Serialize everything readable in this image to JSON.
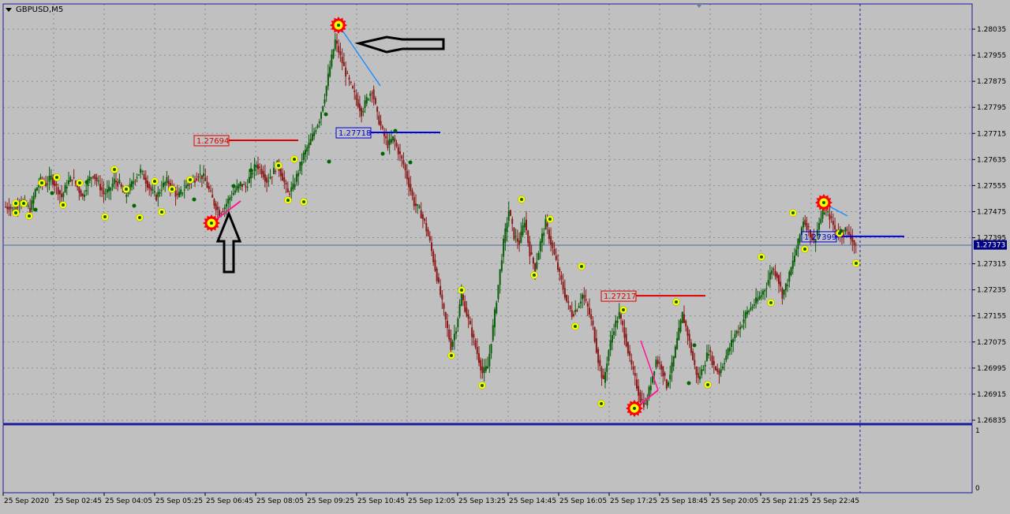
{
  "window": {
    "symbol_timeframe": "GBPUSD,M5"
  },
  "colors": {
    "background": "#c0c0c0",
    "grid": "#8a8a9a",
    "frame": "#1a1a9a",
    "bull_candle": "#0a5e0a",
    "bear_candle": "#8b1a1a",
    "marker_fill": "#ffff00",
    "marker_dot": "#006400",
    "star": "#ff0000",
    "line_blue": "#0000dd",
    "line_red": "#dd0000",
    "line_pink": "#ff1493",
    "line_lightblue": "#1e90ff",
    "current_price_bg": "#000080"
  },
  "chart_data": {
    "type": "candlestick",
    "symbol": "GBPUSD",
    "timeframe": "M5",
    "y_range": [
      1.2683,
      1.281
    ],
    "y_ticks": [
      "1.28035",
      "1.27955",
      "1.27875",
      "1.27795",
      "1.27715",
      "1.27635",
      "1.27555",
      "1.27475",
      "1.27395",
      "1.27315",
      "1.27235",
      "1.27155",
      "1.27075",
      "1.26995",
      "1.26915",
      "1.26835"
    ],
    "x_ticks": [
      "25 Sep 2020",
      "25 Sep 02:45",
      "25 Sep 04:05",
      "25 Sep 05:25",
      "25 Sep 06:45",
      "25 Sep 08:05",
      "25 Sep 09:25",
      "25 Sep 10:45",
      "25 Sep 12:05",
      "25 Sep 13:25",
      "25 Sep 14:45",
      "25 Sep 16:05",
      "25 Sep 17:25",
      "25 Sep 18:45",
      "25 Sep 20:05",
      "25 Sep 21:25",
      "25 Sep 22:45"
    ],
    "current_price": "1.27373",
    "price_levels": [
      {
        "label": "1.27694",
        "value": 1.27694,
        "color": "red"
      },
      {
        "label": "1.27718",
        "value": 1.27718,
        "color": "blue"
      },
      {
        "label": "1.27217",
        "value": 1.27217,
        "color": "red"
      },
      {
        "label": "1.27399",
        "value": 1.27399,
        "color": "blue"
      }
    ],
    "close_path": [
      1.2749,
      1.2749,
      1.2748,
      1.2751,
      1.275,
      1.2748,
      1.2754,
      1.2757,
      1.2756,
      1.2758,
      1.2755,
      1.2752,
      1.2756,
      1.2758,
      1.2755,
      1.2752,
      1.2757,
      1.2759,
      1.2756,
      1.2753,
      1.2754,
      1.2757,
      1.2756,
      1.2752,
      1.2755,
      1.2758,
      1.276,
      1.2757,
      1.2754,
      1.2752,
      1.2755,
      1.2757,
      1.2755,
      1.2752,
      1.2754,
      1.2756,
      1.2757,
      1.2759,
      1.2758,
      1.2754,
      1.275,
      1.2747,
      1.2749,
      1.2752,
      1.2754,
      1.2756,
      1.2755,
      1.2759,
      1.2762,
      1.276,
      1.2757,
      1.2759,
      1.2762,
      1.2758,
      1.2753,
      1.2755,
      1.276,
      1.2765,
      1.2768,
      1.2772,
      1.2776,
      1.2783,
      1.2792,
      1.28,
      1.2795,
      1.279,
      1.2786,
      1.2782,
      1.2778,
      1.2782,
      1.2785,
      1.2777,
      1.2772,
      1.2768,
      1.277,
      1.2766,
      1.2762,
      1.2756,
      1.275,
      1.2748,
      1.2744,
      1.2738,
      1.273,
      1.2722,
      1.2714,
      1.2706,
      1.2712,
      1.2722,
      1.2716,
      1.271,
      1.2704,
      1.2698,
      1.27,
      1.2712,
      1.2725,
      1.2738,
      1.2748,
      1.274,
      1.2738,
      1.2745,
      1.2735,
      1.273,
      1.2738,
      1.2744,
      1.2738,
      1.2732,
      1.2726,
      1.272,
      1.2716,
      1.2718,
      1.2722,
      1.2718,
      1.2712,
      1.2702,
      1.2695,
      1.2705,
      1.2712,
      1.2716,
      1.271,
      1.2702,
      1.2696,
      1.269,
      1.2688,
      1.2695,
      1.2702,
      1.27,
      1.2694,
      1.27,
      1.2708,
      1.2716,
      1.271,
      1.2702,
      1.2696,
      1.27,
      1.2705,
      1.27,
      1.2698,
      1.2702,
      1.2706,
      1.271,
      1.2712,
      1.2716,
      1.2718,
      1.272,
      1.2722,
      1.2725,
      1.273,
      1.2728,
      1.2722,
      1.2726,
      1.2732,
      1.2738,
      1.2745,
      1.2742,
      1.2738,
      1.2744,
      1.2748,
      1.2746,
      1.2742,
      1.274,
      1.2742,
      1.274,
      1.2736
    ]
  }
}
